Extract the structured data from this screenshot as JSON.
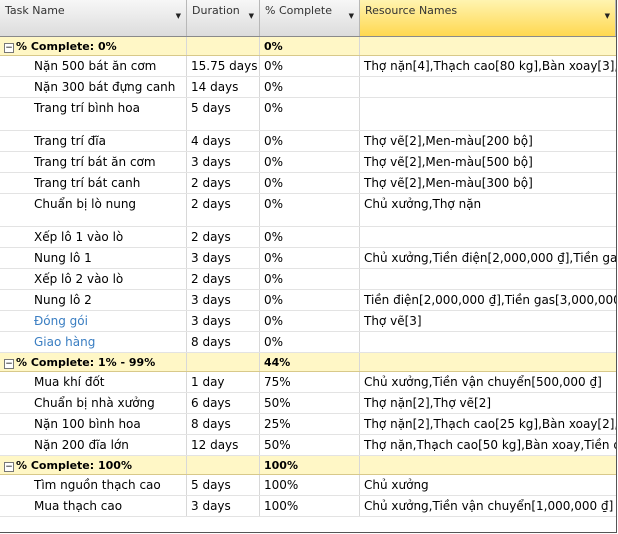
{
  "columns": {
    "task_name": "Task Name",
    "duration": "Duration",
    "complete": "% Complete",
    "resources": "Resource Names"
  },
  "rows": [
    {
      "type": "group",
      "name": "% Complete: 0%",
      "complete": "0%"
    },
    {
      "type": "task",
      "name": "Nặn 500 bát ăn cơm",
      "duration": "15.75 days",
      "complete": "0%",
      "resources": "Thợ nặn[4],Thạch cao[80 kg],Bàn xoay[3],"
    },
    {
      "type": "task",
      "name": "Nặn 300 bát đựng canh",
      "duration": "14 days",
      "complete": "0%",
      "resources": ""
    },
    {
      "type": "task",
      "name": "Trang trí bình hoa",
      "duration": "5 days",
      "complete": "0%",
      "resources": "",
      "tall": true
    },
    {
      "type": "task",
      "name": "Trang trí đĩa",
      "duration": "4 days",
      "complete": "0%",
      "resources": "Thợ vẽ[2],Men-màu[200 bộ]"
    },
    {
      "type": "task",
      "name": "Trang trí bát ăn cơm",
      "duration": "3 days",
      "complete": "0%",
      "resources": "Thợ vẽ[2],Men-màu[500 bộ]"
    },
    {
      "type": "task",
      "name": "Trang trí bát canh",
      "duration": "2 days",
      "complete": "0%",
      "resources": "Thợ vẽ[2],Men-màu[300 bộ]"
    },
    {
      "type": "task",
      "name": "Chuẩn bị lò nung",
      "duration": "2 days",
      "complete": "0%",
      "resources": "Chủ xưởng,Thợ nặn",
      "tall": true
    },
    {
      "type": "task",
      "name": "Xếp lô 1 vào lò",
      "duration": "2 days",
      "complete": "0%",
      "resources": ""
    },
    {
      "type": "task",
      "name": "Nung lô 1",
      "duration": "3 days",
      "complete": "0%",
      "resources": "Chủ xưởng,Tiền điện[2,000,000 ₫],Tiền ga"
    },
    {
      "type": "task",
      "name": "Xếp lô 2 vào lò",
      "duration": "2 days",
      "complete": "0%",
      "resources": ""
    },
    {
      "type": "task",
      "name": "Nung lô 2",
      "duration": "3 days",
      "complete": "0%",
      "resources": "Tiền điện[2,000,000 ₫],Tiền gas[3,000,000"
    },
    {
      "type": "task",
      "name": "Đóng gói",
      "duration": "3 days",
      "complete": "0%",
      "resources": "Thợ vẽ[3]",
      "link": true
    },
    {
      "type": "task",
      "name": "Giao hàng",
      "duration": "8 days",
      "complete": "0%",
      "resources": "",
      "link": true
    },
    {
      "type": "group",
      "name": "% Complete: 1% - 99%",
      "complete": "44%"
    },
    {
      "type": "task",
      "name": "Mua khí đốt",
      "duration": "1 day",
      "complete": "75%",
      "resources": "Chủ xưởng,Tiền vận chuyển[500,000 ₫]"
    },
    {
      "type": "task",
      "name": "Chuẩn bị nhà xưởng",
      "duration": "6 days",
      "complete": "50%",
      "resources": "Thợ nặn[2],Thợ vẽ[2]"
    },
    {
      "type": "task",
      "name": "Nặn 100 bình hoa",
      "duration": "8 days",
      "complete": "25%",
      "resources": "Thợ nặn[2],Thạch cao[25 kg],Bàn xoay[2],"
    },
    {
      "type": "task",
      "name": "Nặn 200 đĩa lớn",
      "duration": "12 days",
      "complete": "50%",
      "resources": "Thợ nặn,Thạch cao[50 kg],Bàn xoay,Tiền đ"
    },
    {
      "type": "group",
      "name": "% Complete: 100%",
      "complete": "100%"
    },
    {
      "type": "task",
      "name": "Tìm nguồn thạch cao",
      "duration": "5 days",
      "complete": "100%",
      "resources": "Chủ xưởng"
    },
    {
      "type": "task",
      "name": "Mua thạch cao",
      "duration": "3 days",
      "complete": "100%",
      "resources": "Chủ xưởng,Tiền vận chuyển[1,000,000 ₫]"
    }
  ]
}
